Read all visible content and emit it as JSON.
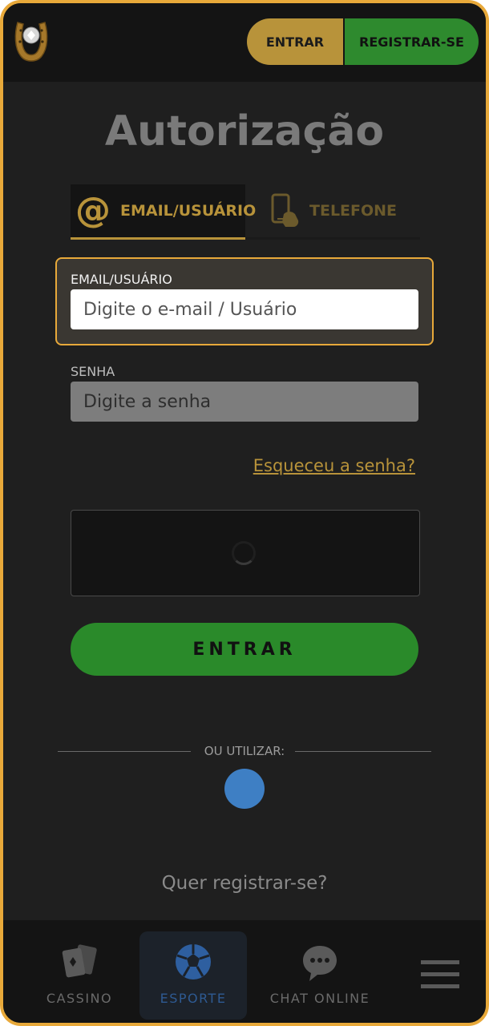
{
  "header": {
    "login_button": "ENTRAR",
    "register_button": "REGISTRAR-SE"
  },
  "page": {
    "title": "Autorização"
  },
  "tabs": [
    {
      "label": "EMAIL/USUÁRIO",
      "active": true
    },
    {
      "label": "TELEFONE",
      "active": false
    }
  ],
  "form": {
    "email_label": "EMAIL/USUÁRIO",
    "email_placeholder": "Digite o e-mail / Usuário",
    "password_label": "SENHA",
    "password_placeholder": "Digite a senha",
    "forgot_link": "Esqueceu a senha?",
    "submit_button": "ENTRAR"
  },
  "social": {
    "divider_text": "OU UTILIZAR:"
  },
  "register_prompt": "Quer registrar-se?",
  "bottom_nav": [
    {
      "label": "CASSINO",
      "icon": "cards-icon"
    },
    {
      "label": "ESPORTE",
      "icon": "soccer-ball-icon",
      "active": true
    },
    {
      "label": "CHAT ONLINE",
      "icon": "chat-bubble-icon"
    },
    {
      "label": "",
      "icon": "hamburger-menu-icon"
    }
  ],
  "colors": {
    "accent_gold": "#b8933a",
    "border_highlight": "#e8a93a",
    "green": "#2a8a2a",
    "background": "#1f1f1f",
    "social_blue": "#3e7fc4"
  }
}
